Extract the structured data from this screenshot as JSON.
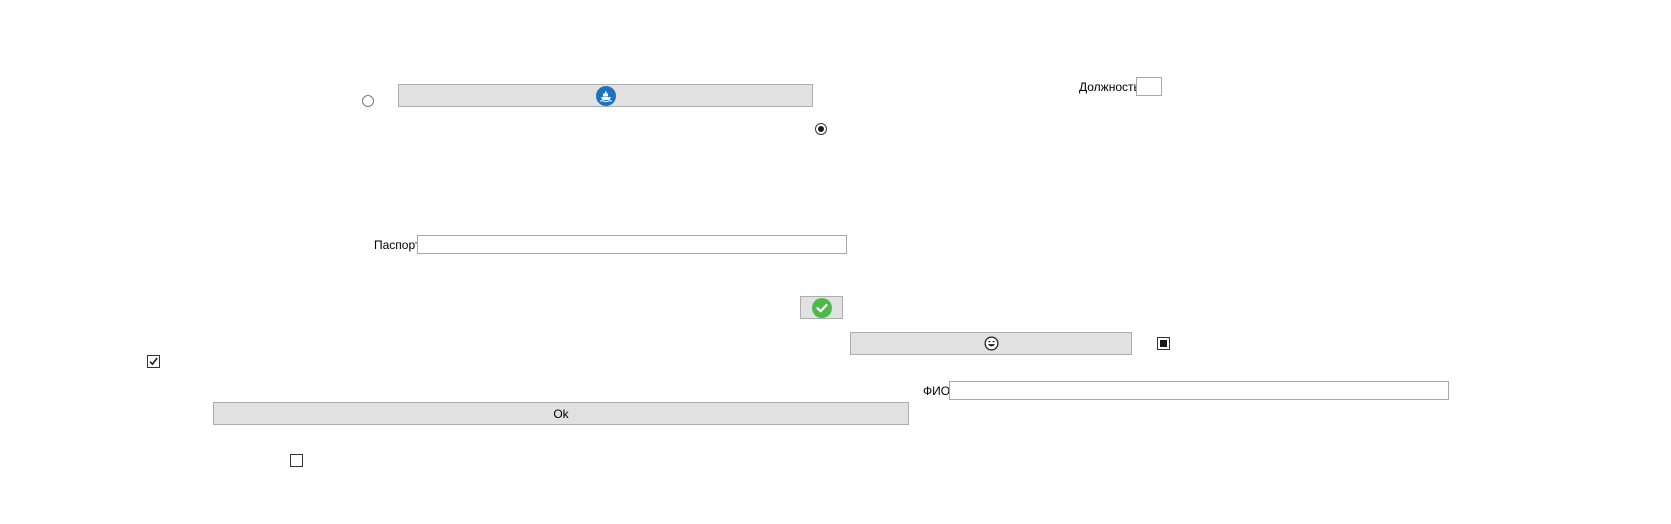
{
  "fields": {
    "position_label": "Должность",
    "position_value": "",
    "passport_label": "Паспорт",
    "passport_value": "",
    "fio_label": "ФИО",
    "fio_value": ""
  },
  "buttons": {
    "ok_label": "Ok",
    "top_button_icon": "ship-icon",
    "check_button_icon": "checkmark-icon",
    "middle_button_icon": "smiley-icon"
  },
  "controls": {
    "radio_left_checked": false,
    "radio_right_checked": true,
    "checkbox_left_checked": true,
    "checkbox_bottom_checked": false,
    "checkbox_right_state": "indeterminate"
  },
  "colors": {
    "ship_icon_bg": "#1e73be",
    "check_icon_bg": "#4cbb47",
    "button_face": "#e1e1e1",
    "button_border": "#adadad"
  }
}
